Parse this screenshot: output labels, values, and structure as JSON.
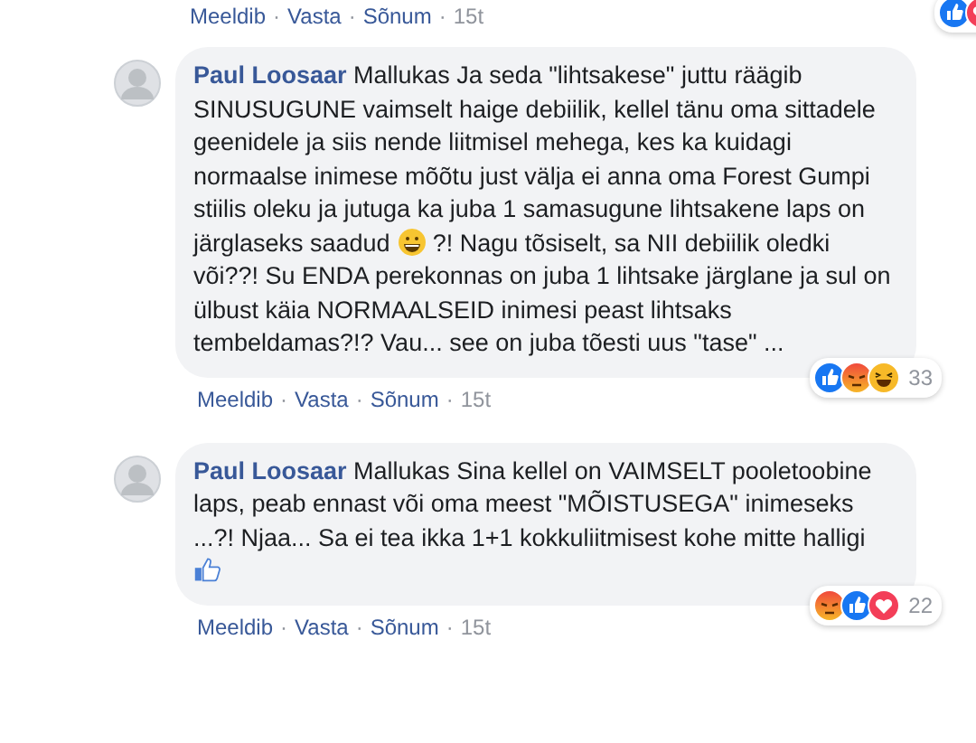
{
  "top_actions": {
    "links": [
      "Meeldib",
      "Vasta",
      "Sõnum"
    ],
    "separator": "·",
    "time": "15t",
    "reactions": [
      {
        "kind": "like"
      },
      {
        "kind": "love"
      }
    ]
  },
  "comments": [
    {
      "author": "Paul Loosaar",
      "segments": [
        {
          "kind": "text",
          "text": "Mallukas Ja seda \"lihtsakese\" juttu räägib SINUSUGUNE vaimselt haige debiilik, kellel tänu oma sittadele geenidele ja siis nende liitmisel mehega, kes ka kuidagi normaalse inimese mõõtu just välja ei anna oma Forest Gumpi stiilis oleku ja jutuga ka juba 1 samasugune lihtsakene laps on järglaseks saadud "
        },
        {
          "kind": "grin"
        },
        {
          "kind": "text",
          "text": " ?! Nagu tõsiselt, sa NII debiilik oledki või??! Su ENDA perekonnas on juba 1 lihtsake järglane ja sul on ülbust käia NORMAALSEID inimesi peast lihtsaks tembeldamas?!? Vau... see on juba tõesti uus \"tase\" ..."
        }
      ],
      "reactions": [
        {
          "kind": "like"
        },
        {
          "kind": "angry"
        },
        {
          "kind": "haha"
        }
      ],
      "count": "33",
      "links": [
        "Meeldib",
        "Vasta",
        "Sõnum"
      ],
      "separator": "·",
      "time": "15t"
    },
    {
      "author": "Paul Loosaar",
      "segments": [
        {
          "kind": "text",
          "text": "Mallukas Sina kellel on VAIMSELT pooletoobine laps, peab ennast või oma meest \"MÕISTUSEGA\" inimeseks ...?! Njaa... Sa ei tea ikka 1+1 kokkuliitmisest kohe mitte halligi "
        },
        {
          "kind": "thumbs-up"
        }
      ],
      "reactions": [
        {
          "kind": "angry"
        },
        {
          "kind": "like"
        },
        {
          "kind": "love"
        }
      ],
      "count": "22",
      "links": [
        "Meeldib",
        "Vasta",
        "Sõnum"
      ],
      "separator": "·",
      "time": "15t"
    }
  ]
}
